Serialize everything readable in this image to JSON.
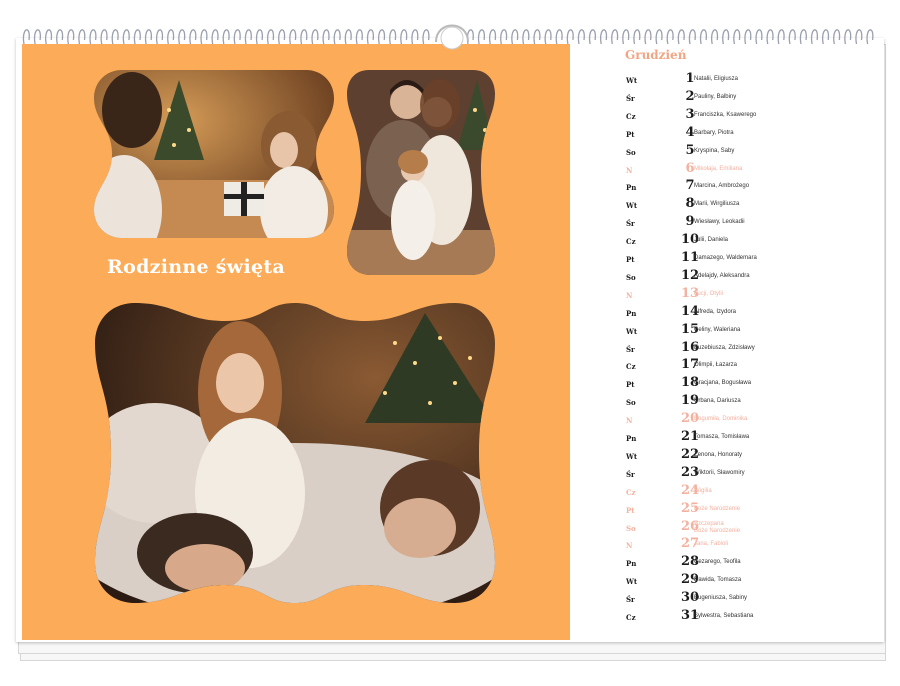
{
  "calendar": {
    "title": "Rodzinne święta",
    "month": "Grudzień",
    "accent_color": "#fcac59",
    "holiday_color": "#f3b1a0",
    "photos": [
      {
        "name": "mother-daughter-gift-photo"
      },
      {
        "name": "family-couple-child-photo"
      },
      {
        "name": "child-parents-bed-photo"
      }
    ],
    "days": [
      {
        "dw": "Wt",
        "dn": "1",
        "names": "Natalii, Eligiusza",
        "holiday": false
      },
      {
        "dw": "Śr",
        "dn": "2",
        "names": "Pauliny, Balbiny",
        "holiday": false
      },
      {
        "dw": "Cz",
        "dn": "3",
        "names": "Franciszka, Ksawerego",
        "holiday": false
      },
      {
        "dw": "Pt",
        "dn": "4",
        "names": "Barbary, Piotra",
        "holiday": false
      },
      {
        "dw": "So",
        "dn": "5",
        "names": "Kryspina, Saby",
        "holiday": false
      },
      {
        "dw": "N",
        "dn": "6",
        "names": "Mikołaja, Emiliana",
        "holiday": true
      },
      {
        "dw": "Pn",
        "dn": "7",
        "names": "Marcina, Ambrożego",
        "holiday": false
      },
      {
        "dw": "Wt",
        "dn": "8",
        "names": "Marii, Wirgiliusza",
        "holiday": false
      },
      {
        "dw": "Śr",
        "dn": "9",
        "names": "Wiesławy, Leokadii",
        "holiday": false
      },
      {
        "dw": "Cz",
        "dn": "10",
        "names": "Julii, Daniela",
        "holiday": false
      },
      {
        "dw": "Pt",
        "dn": "11",
        "names": "Damazego, Waldemara",
        "holiday": false
      },
      {
        "dw": "So",
        "dn": "12",
        "names": "Adelajdy, Aleksandra",
        "holiday": false
      },
      {
        "dw": "N",
        "dn": "13",
        "names": "Łucji, Otylii",
        "holiday": true
      },
      {
        "dw": "Pn",
        "dn": "14",
        "names": "Alfreda, Izydora",
        "holiday": false
      },
      {
        "dw": "Wt",
        "dn": "15",
        "names": "Celiny, Waleriana",
        "holiday": false
      },
      {
        "dw": "Śr",
        "dn": "16",
        "names": "Euzebiusza, Zdzisławy",
        "holiday": false
      },
      {
        "dw": "Cz",
        "dn": "17",
        "names": "Olimpii, Łazarza",
        "holiday": false
      },
      {
        "dw": "Pt",
        "dn": "18",
        "names": "Gracjana, Bogusława",
        "holiday": false
      },
      {
        "dw": "So",
        "dn": "19",
        "names": "Urbana, Dariusza",
        "holiday": false
      },
      {
        "dw": "N",
        "dn": "20",
        "names": "Bogumiła, Dominika",
        "holiday": true
      },
      {
        "dw": "Pn",
        "dn": "21",
        "names": "Tomasza, Tomisława",
        "holiday": false
      },
      {
        "dw": "Wt",
        "dn": "22",
        "names": "Zenona, Honoraty",
        "holiday": false
      },
      {
        "dw": "Śr",
        "dn": "23",
        "names": "Wiktorii, Sławomiry",
        "holiday": false
      },
      {
        "dw": "Cz",
        "dn": "24",
        "names": "Wigilia",
        "holiday": true
      },
      {
        "dw": "Pt",
        "dn": "25",
        "names": "Boże Narodzenie",
        "holiday": true
      },
      {
        "dw": "So",
        "dn": "26",
        "names": "Szczepana",
        "names2": "Boże Narodzenie",
        "holiday": true
      },
      {
        "dw": "N",
        "dn": "27",
        "names": "Jana, Fabioli",
        "holiday": true
      },
      {
        "dw": "Pn",
        "dn": "28",
        "names": "Cezarego, Teofila",
        "holiday": false
      },
      {
        "dw": "Wt",
        "dn": "29",
        "names": "Dawida, Tomasza",
        "holiday": false
      },
      {
        "dw": "Śr",
        "dn": "30",
        "names": "Eugeniusza, Sabiny",
        "holiday": false
      },
      {
        "dw": "Cz",
        "dn": "31",
        "names": "Sylwestra, Sebastiana",
        "holiday": false
      }
    ]
  }
}
